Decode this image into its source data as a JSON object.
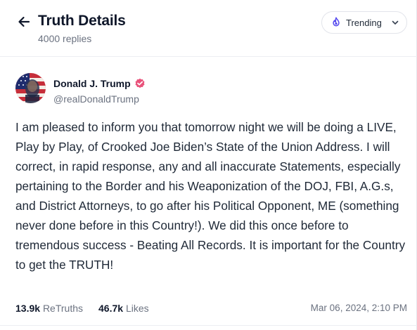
{
  "header": {
    "title": "Truth Details",
    "subtitle": "4000 replies",
    "sort_label": "Trending"
  },
  "post": {
    "author_name": "Donald J. Trump",
    "author_handle": "@realDonaldTrump",
    "body": "I am pleased to inform you that tomorrow night we will be doing a LIVE, Play by Play, of Crooked Joe Biden’s State of the Union Address. I will correct, in rapid response, any and all inaccurate Statements, especially pertaining to the Border and his Weaponization of the DOJ, FBI, A.G.s, and District Attorneys, to go after his Political Opponent, ME (something never done before in this Country!). We did this once before to tremendous success - Beating All Records. It is important for the Country to get the TRUTH!",
    "retruths_count": "13.9k",
    "retruths_label": "ReTruths",
    "likes_count": "46.7k",
    "likes_label": "Likes",
    "timestamp": "Mar 06, 2024, 2:10 PM"
  },
  "icons": {
    "back": "arrow-left-icon",
    "sort": "flame-icon",
    "dropdown": "chevron-down-icon",
    "verified": "verified-badge-icon"
  },
  "colors": {
    "accent": "#5448ee",
    "verified": "#e9537b",
    "muted_text": "#6b7280"
  }
}
